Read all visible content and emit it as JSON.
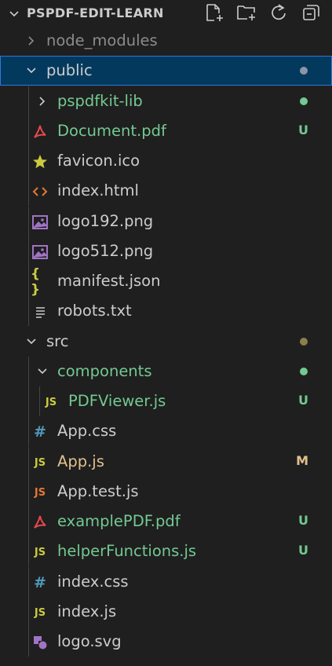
{
  "header": {
    "title": "PSPDF-EDIT-LEARN",
    "actions": [
      "new-file-icon",
      "new-folder-icon",
      "refresh-icon",
      "collapse-all-icon"
    ]
  },
  "tree": {
    "node_modules": "node_modules",
    "public": "public",
    "pspdfkit_lib": "pspdfkit-lib",
    "document_pdf": "Document.pdf",
    "favicon": "favicon.ico",
    "index_html": "index.html",
    "logo192": "logo192.png",
    "logo512": "logo512.png",
    "manifest": "manifest.json",
    "robots": "robots.txt",
    "src": "src",
    "components": "components",
    "pdfviewer": "PDFViewer.js",
    "app_css": "App.css",
    "app_js": "App.js",
    "app_test": "App.test.js",
    "example_pdf": "examplePDF.pdf",
    "helper": "helperFunctions.js",
    "index_css": "index.css",
    "index_js": "index.js",
    "logo_svg": "logo.svg"
  },
  "badges": {
    "untracked": "U",
    "modified": "M"
  },
  "icons": {
    "js": "JS",
    "hash": "#",
    "braces": "{ }"
  },
  "colors": {
    "untracked": "#73c991",
    "modified": "#e2c08d",
    "selected_bg": "#04395e",
    "selected_border": "#2b79d8"
  }
}
